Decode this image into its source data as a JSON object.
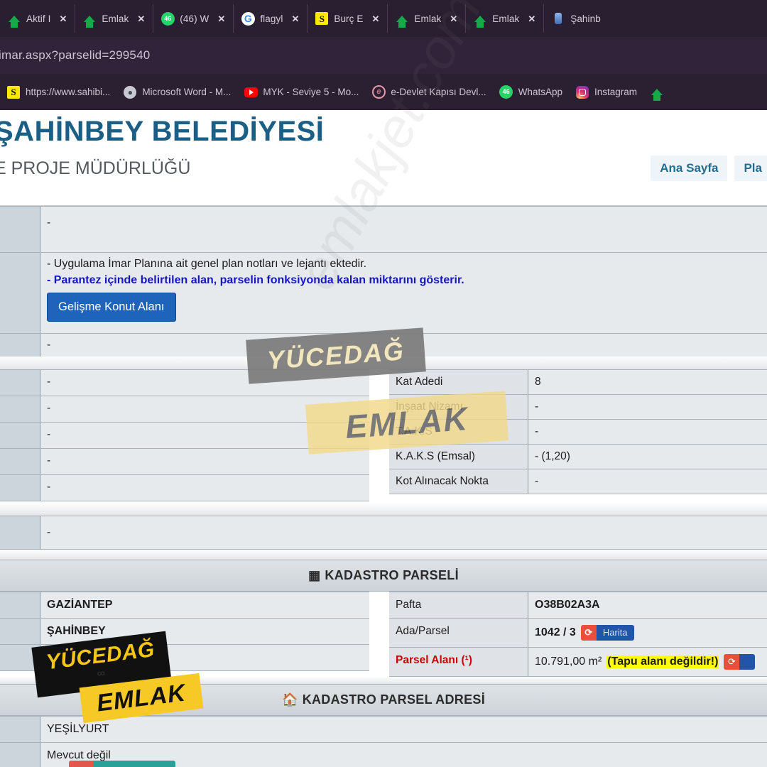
{
  "browser": {
    "tabs": [
      {
        "title": "Aktif I",
        "icon": "house-green-icon",
        "close": "✕"
      },
      {
        "title": "Emlak",
        "icon": "house-green-icon",
        "close": "✕"
      },
      {
        "title": "(46) W",
        "icon": "whatsapp-icon",
        "badge": "46",
        "close": "✕"
      },
      {
        "title": "flagyl",
        "icon": "google-icon",
        "close": "✕"
      },
      {
        "title": "Burç E",
        "icon": "sahibinden-icon",
        "close": "✕"
      },
      {
        "title": "Emlak",
        "icon": "house-green-icon",
        "close": "✕"
      },
      {
        "title": "Emlak",
        "icon": "house-green-icon",
        "close": "✕"
      },
      {
        "title": "Şahinb",
        "icon": "blue-pin-icon",
        "close": ""
      }
    ],
    "url": "imar.aspx?parselid=299540",
    "bookmarks": [
      {
        "label": "https://www.sahibi...",
        "icon": "sahibinden-icon"
      },
      {
        "label": "Microsoft Word - M...",
        "icon": "word-icon"
      },
      {
        "label": "MYK - Seviye 5 - Mo...",
        "icon": "youtube-icon"
      },
      {
        "label": "e-Devlet Kapısı Devl...",
        "icon": "edevlet-icon"
      },
      {
        "label": "WhatsApp",
        "icon": "whatsapp-icon"
      },
      {
        "label": "Instagram",
        "icon": "instagram-icon"
      },
      {
        "label": "",
        "icon": "house-green-icon"
      }
    ]
  },
  "site": {
    "title": "ŞAHİNBEY BELEDİYESİ",
    "subtitle": "E PROJE MÜDÜRLÜĞÜ",
    "nav": [
      {
        "label": "Ana Sayfa"
      },
      {
        "label": "Pla"
      }
    ]
  },
  "imar": {
    "rows_top": [
      {
        "value": "-"
      }
    ],
    "notes": {
      "line1": "- Uygulama İmar Planına ait genel plan notları ve lejantı ektedir.",
      "line2": "- Parantez içinde belirtilen alan, parselin fonksiyonda kalan miktarını gösterir.",
      "button": "Gelişme Konut Alanı"
    },
    "rows_after_notes": [
      {
        "value": "-"
      }
    ],
    "left_rows": [
      {
        "value": "-"
      },
      {
        "value": "-"
      },
      {
        "value": "-"
      },
      {
        "value": "-"
      },
      {
        "value": "-"
      }
    ],
    "right_rows": [
      {
        "key": "Kat Adedi",
        "value": "8"
      },
      {
        "key": "İnşaat Nizamı",
        "value": "-"
      },
      {
        "key": "T.A.K.S",
        "value": "-"
      },
      {
        "key": "K.A.K.S (Emsal)",
        "value": "- (1,20)"
      },
      {
        "key": "Kot Alınacak Nokta",
        "value": "-"
      }
    ],
    "rows_bottom": [
      {
        "value": "-"
      }
    ]
  },
  "kadastro": {
    "header": "KADASTRO PARSELİ",
    "header_icon": "grid-squares-icon",
    "left_rows": [
      {
        "value": "GAZİANTEP"
      },
      {
        "value": "ŞAHİNBEY"
      },
      {
        "value": ""
      }
    ],
    "right_rows": [
      {
        "key": "Pafta",
        "value": "O38B02A3A",
        "bold": true
      },
      {
        "key": "Ada/Parsel",
        "value": "1042 / 3",
        "map_button": "Harita"
      },
      {
        "key": "Parsel Alanı (¹)",
        "value": "10.791,00 m²",
        "highlight": "(Tapu alanı değildir!)",
        "key_red": true
      }
    ]
  },
  "adres": {
    "header": "KADASTRO PARSEL ADRESİ",
    "header_icon": "home-icon",
    "rows": [
      {
        "value": "YEŞİLYURT"
      },
      {
        "value": "Mevcut değil"
      }
    ]
  },
  "watermarks": {
    "gray_tag": "YÜCEDAĞ",
    "yellow_tag": "EMLAK",
    "diagonal": "emlakjet.com"
  },
  "logo": {
    "line1": "YÜCEDAĞ",
    "line2": "∞",
    "line3": "EMLAK"
  },
  "colors": {
    "brand_blue": "#1c5f86",
    "note_blue": "#1515c8",
    "btn_blue": "#1f64bb",
    "red": "#cc0000",
    "highlight_yellow": "#ffff00",
    "logo_yellow": "#f7c927"
  }
}
